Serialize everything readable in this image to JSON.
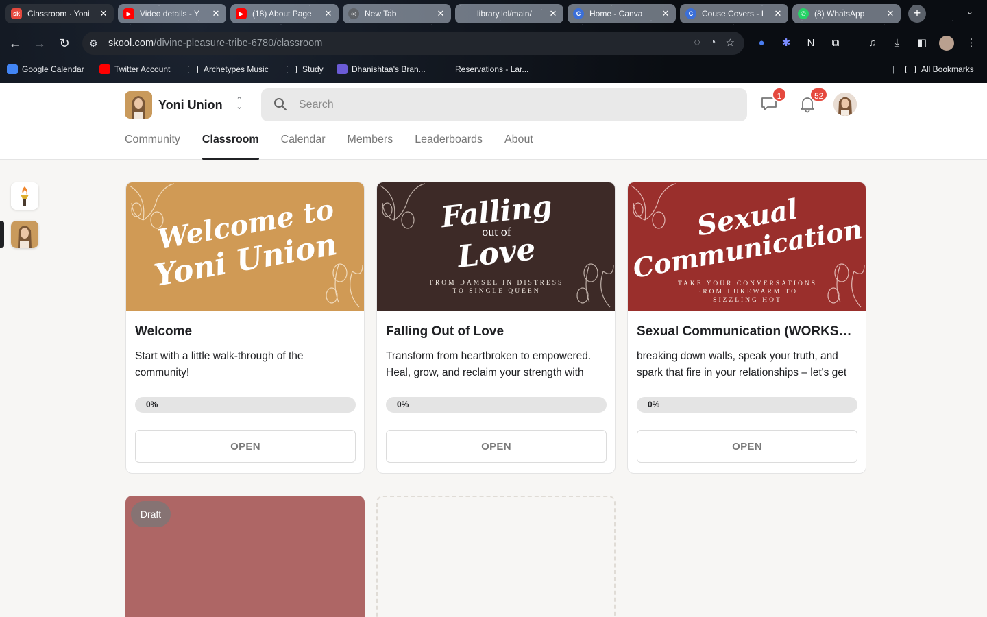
{
  "browser": {
    "tabs": [
      {
        "title": "Classroom · Yoni",
        "favicon": "skool-icon",
        "active": true
      },
      {
        "title": "Video details - Y",
        "favicon": "youtube-icon"
      },
      {
        "title": "(18) About Page",
        "favicon": "youtube-icon"
      },
      {
        "title": "New Tab",
        "favicon": "chrome-icon"
      },
      {
        "title": "library.lol/main/",
        "favicon": "globe-icon"
      },
      {
        "title": "Home - Canva",
        "favicon": "canva-icon"
      },
      {
        "title": "Couse Covers - I",
        "favicon": "canva-icon"
      },
      {
        "title": "(8) WhatsApp",
        "favicon": "whatsapp-icon"
      }
    ],
    "url_domain": "skool.com",
    "url_path": "/divine-pleasure-tribe-6780/classroom",
    "bookmarks": [
      {
        "label": "Google Calendar",
        "icon": "calendar-icon"
      },
      {
        "label": "Twitter Account",
        "icon": "youtube-icon"
      },
      {
        "label": "Archetypes Music",
        "icon": "folder-icon"
      },
      {
        "label": "Study",
        "icon": "folder-icon"
      },
      {
        "label": "Dhanishtaa's Bran...",
        "icon": "brand-icon"
      },
      {
        "label": "Reservations - Lar...",
        "icon": "none"
      }
    ],
    "all_bookmarks": "All Bookmarks"
  },
  "header": {
    "group_name": "Yoni Union",
    "search_placeholder": "Search",
    "chat_badge": "1",
    "notification_badge": "52",
    "nav_tabs": [
      "Community",
      "Classroom",
      "Calendar",
      "Members",
      "Leaderboards",
      "About"
    ],
    "active_tab": "Classroom"
  },
  "courses": [
    {
      "cover_title_1": "Welcome to",
      "cover_title_2": "Yoni Union",
      "cover_sub_1": "",
      "cover_sub_2": "",
      "cover_sub_3": "",
      "title": "Welcome",
      "description": "Start with a little walk-through of the community!",
      "progress": "0%",
      "progress_value": 0,
      "button": "OPEN",
      "color": "#d09a55"
    },
    {
      "cover_title_1": "Falling",
      "cover_title_mid": "out of",
      "cover_title_2": "Love",
      "cover_sub_1": "FROM DAMSEL IN DISTRESS",
      "cover_sub_2": "TO SINGLE QUEEN",
      "cover_sub_3": "",
      "title": "Falling Out of Love",
      "description": "Transform from heartbroken to empowered. Heal, grow, and reclaim your strength with",
      "progress": "0%",
      "progress_value": 0,
      "button": "OPEN",
      "color": "#3d2a27"
    },
    {
      "cover_title_1": "Sexual",
      "cover_title_2": "Communication",
      "cover_sub_1": "TAKE YOUR CONVERSATIONS",
      "cover_sub_2": "FROM LUKEWARM TO",
      "cover_sub_3": "SIZZLING HOT",
      "title": "Sexual Communication (WORKSH...",
      "description": "breaking down walls, speak your truth, and spark that fire in your relationships – let's get",
      "progress": "0%",
      "progress_value": 0,
      "button": "OPEN",
      "color": "#9a2f2c"
    }
  ],
  "draft_course": {
    "badge": "Draft",
    "color": "#ae6665"
  }
}
